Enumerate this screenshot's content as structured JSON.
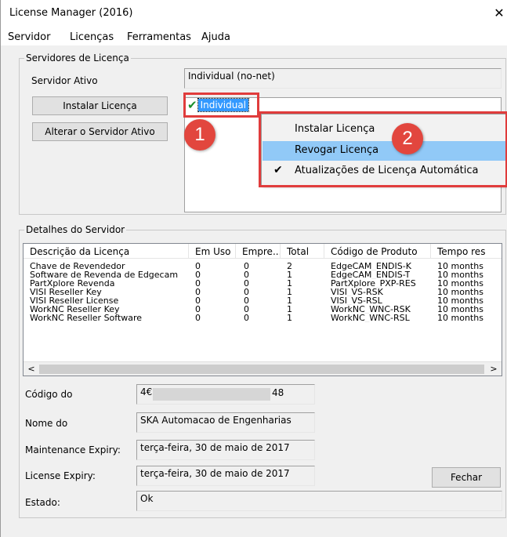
{
  "window": {
    "title": "License Manager (2016)",
    "close_glyph": "✕"
  },
  "menu": [
    "Servidor",
    "Licenças",
    "Ferramentas",
    "Ajuda"
  ],
  "servers_group": {
    "legend": "Servidores de Licença",
    "active_label": "Servidor Ativo",
    "active_value": "Individual (no-net)",
    "install_button": "Instalar Licença",
    "change_button": "Alterar o Servidor Ativo",
    "selected_server": "Individual"
  },
  "badges": [
    "1",
    "2"
  ],
  "context_menu": {
    "items": [
      {
        "label": "Instalar Licença",
        "checked": false,
        "hover": false
      },
      {
        "label": "Revogar Licença",
        "checked": false,
        "hover": true
      },
      {
        "label": "Atualizações de Licença Automática",
        "checked": true,
        "hover": false
      }
    ],
    "check_glyph": "✔",
    "hover_color": "#91c9f7"
  },
  "details_group": {
    "legend": "Detalhes do Servidor",
    "columns": [
      "Descrição da Licença",
      "Em Uso",
      "Empre...",
      "Total",
      "Código de Produto",
      "Tempo res"
    ],
    "rows": [
      [
        "Chave de Revendedor",
        "0",
        "0",
        "2",
        "EdgeCAM_ENDIS-K",
        "10 months"
      ],
      [
        "Software de Revenda de Edgecam",
        "0",
        "0",
        "1",
        "EdgeCAM_ENDIS-T",
        "10 months"
      ],
      [
        "PartXplore Revenda",
        "0",
        "0",
        "1",
        "PartXplore_PXP-RES",
        "10 months"
      ],
      [
        "VISI Reseller Key",
        "0",
        "0",
        "1",
        "VISI_VS-RSK",
        "10 months"
      ],
      [
        "VISI Reseller License",
        "0",
        "0",
        "1",
        "VISI_VS-RSL",
        "10 months"
      ],
      [
        "WorkNC Reseller Key",
        "0",
        "0",
        "1",
        "WorkNC_WNC-RSK",
        "10 months"
      ],
      [
        "WorkNC Reseller Software",
        "0",
        "0",
        "1",
        "WorkNC_WNC-RSL",
        "10 months"
      ]
    ],
    "scroll_left": "<",
    "scroll_right": ">"
  },
  "fields": {
    "code_label": "Código do",
    "code_value_start": "4€",
    "code_value_end": "48",
    "name_label": "Nome do",
    "name_value": "SKA Automacao de Engenharias",
    "maintenance_label": "Maintenance Expiry:",
    "maintenance_value": "terça-feira, 30 de maio de 2017",
    "license_label": "License Expiry:",
    "license_value": "terça-feira, 30 de maio de 2017",
    "state_label": "Estado:",
    "state_value": "Ok",
    "close_button": "Fechar"
  },
  "colors": {
    "highlight_red": "#e03c3c",
    "badge_red": "#e2463e",
    "selection_blue": "#3399ff",
    "check_green": "#1a8f2e"
  }
}
